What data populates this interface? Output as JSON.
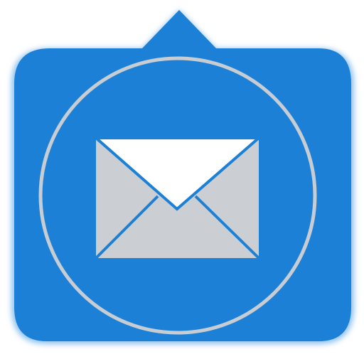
{
  "icon": {
    "name": "mail-icon",
    "shape": "speech-bubble-rounded-square",
    "colors": {
      "background": "#ffffff",
      "bubble": "#1b80d6",
      "bubble_glow": "#8fc3ef",
      "ring": "#c8cdd3",
      "envelope_body": "#cbced3",
      "envelope_flap": "#ffffff",
      "envelope_fold_lines": "#1b80d6"
    }
  }
}
